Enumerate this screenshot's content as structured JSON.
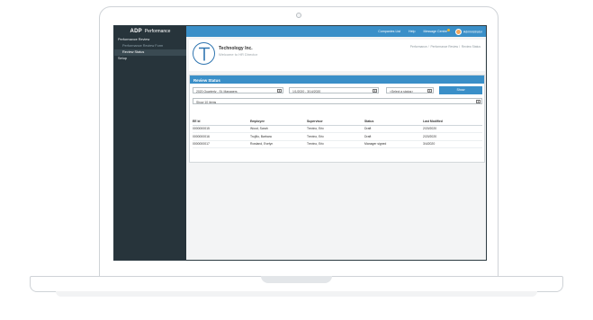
{
  "app": {
    "brand_logo": "ADP",
    "brand_name": "Performance"
  },
  "topbar": {
    "links": [
      "Companies List",
      "Help",
      "Message Centre"
    ],
    "user": "Administrator"
  },
  "sidebar": {
    "items": [
      {
        "label": "Performance Review"
      },
      {
        "label": "Performance Review Form"
      },
      {
        "label": "Review Status"
      },
      {
        "label": "Setup"
      }
    ]
  },
  "company": {
    "logo_letter": "T",
    "name": "Technology Inc.",
    "welcome": "Welcome to HR Director"
  },
  "breadcrumb": [
    "Performance",
    "Performance Review",
    "Review Status"
  ],
  "review_status": {
    "title": "Review Status",
    "filters": {
      "period": "2020 Quarterly - St. Managers",
      "date_range": "1/1/2020 - 3/14/2020",
      "status": "<Select a status>",
      "show_label": "Show"
    },
    "items_per_page": "Show 10 items",
    "columns": [
      "EE Id",
      "Employee",
      "Supervisor",
      "Status",
      "Last Modified"
    ],
    "rows": [
      [
        "0000000015",
        "Wood, Sarah",
        "Trevino, Eric",
        "Draft",
        "2/20/2020"
      ],
      [
        "0000000016",
        "Trujillo, Barbara",
        "Trevino, Eric",
        "Draft",
        "2/20/2020"
      ],
      [
        "0000000017",
        "Rowland, Evelyn",
        "Trevino, Eric",
        "Manager signed",
        "3/4/2020"
      ]
    ]
  },
  "colors": {
    "accent": "#3a8fc8",
    "sidebar": "#27343b"
  }
}
